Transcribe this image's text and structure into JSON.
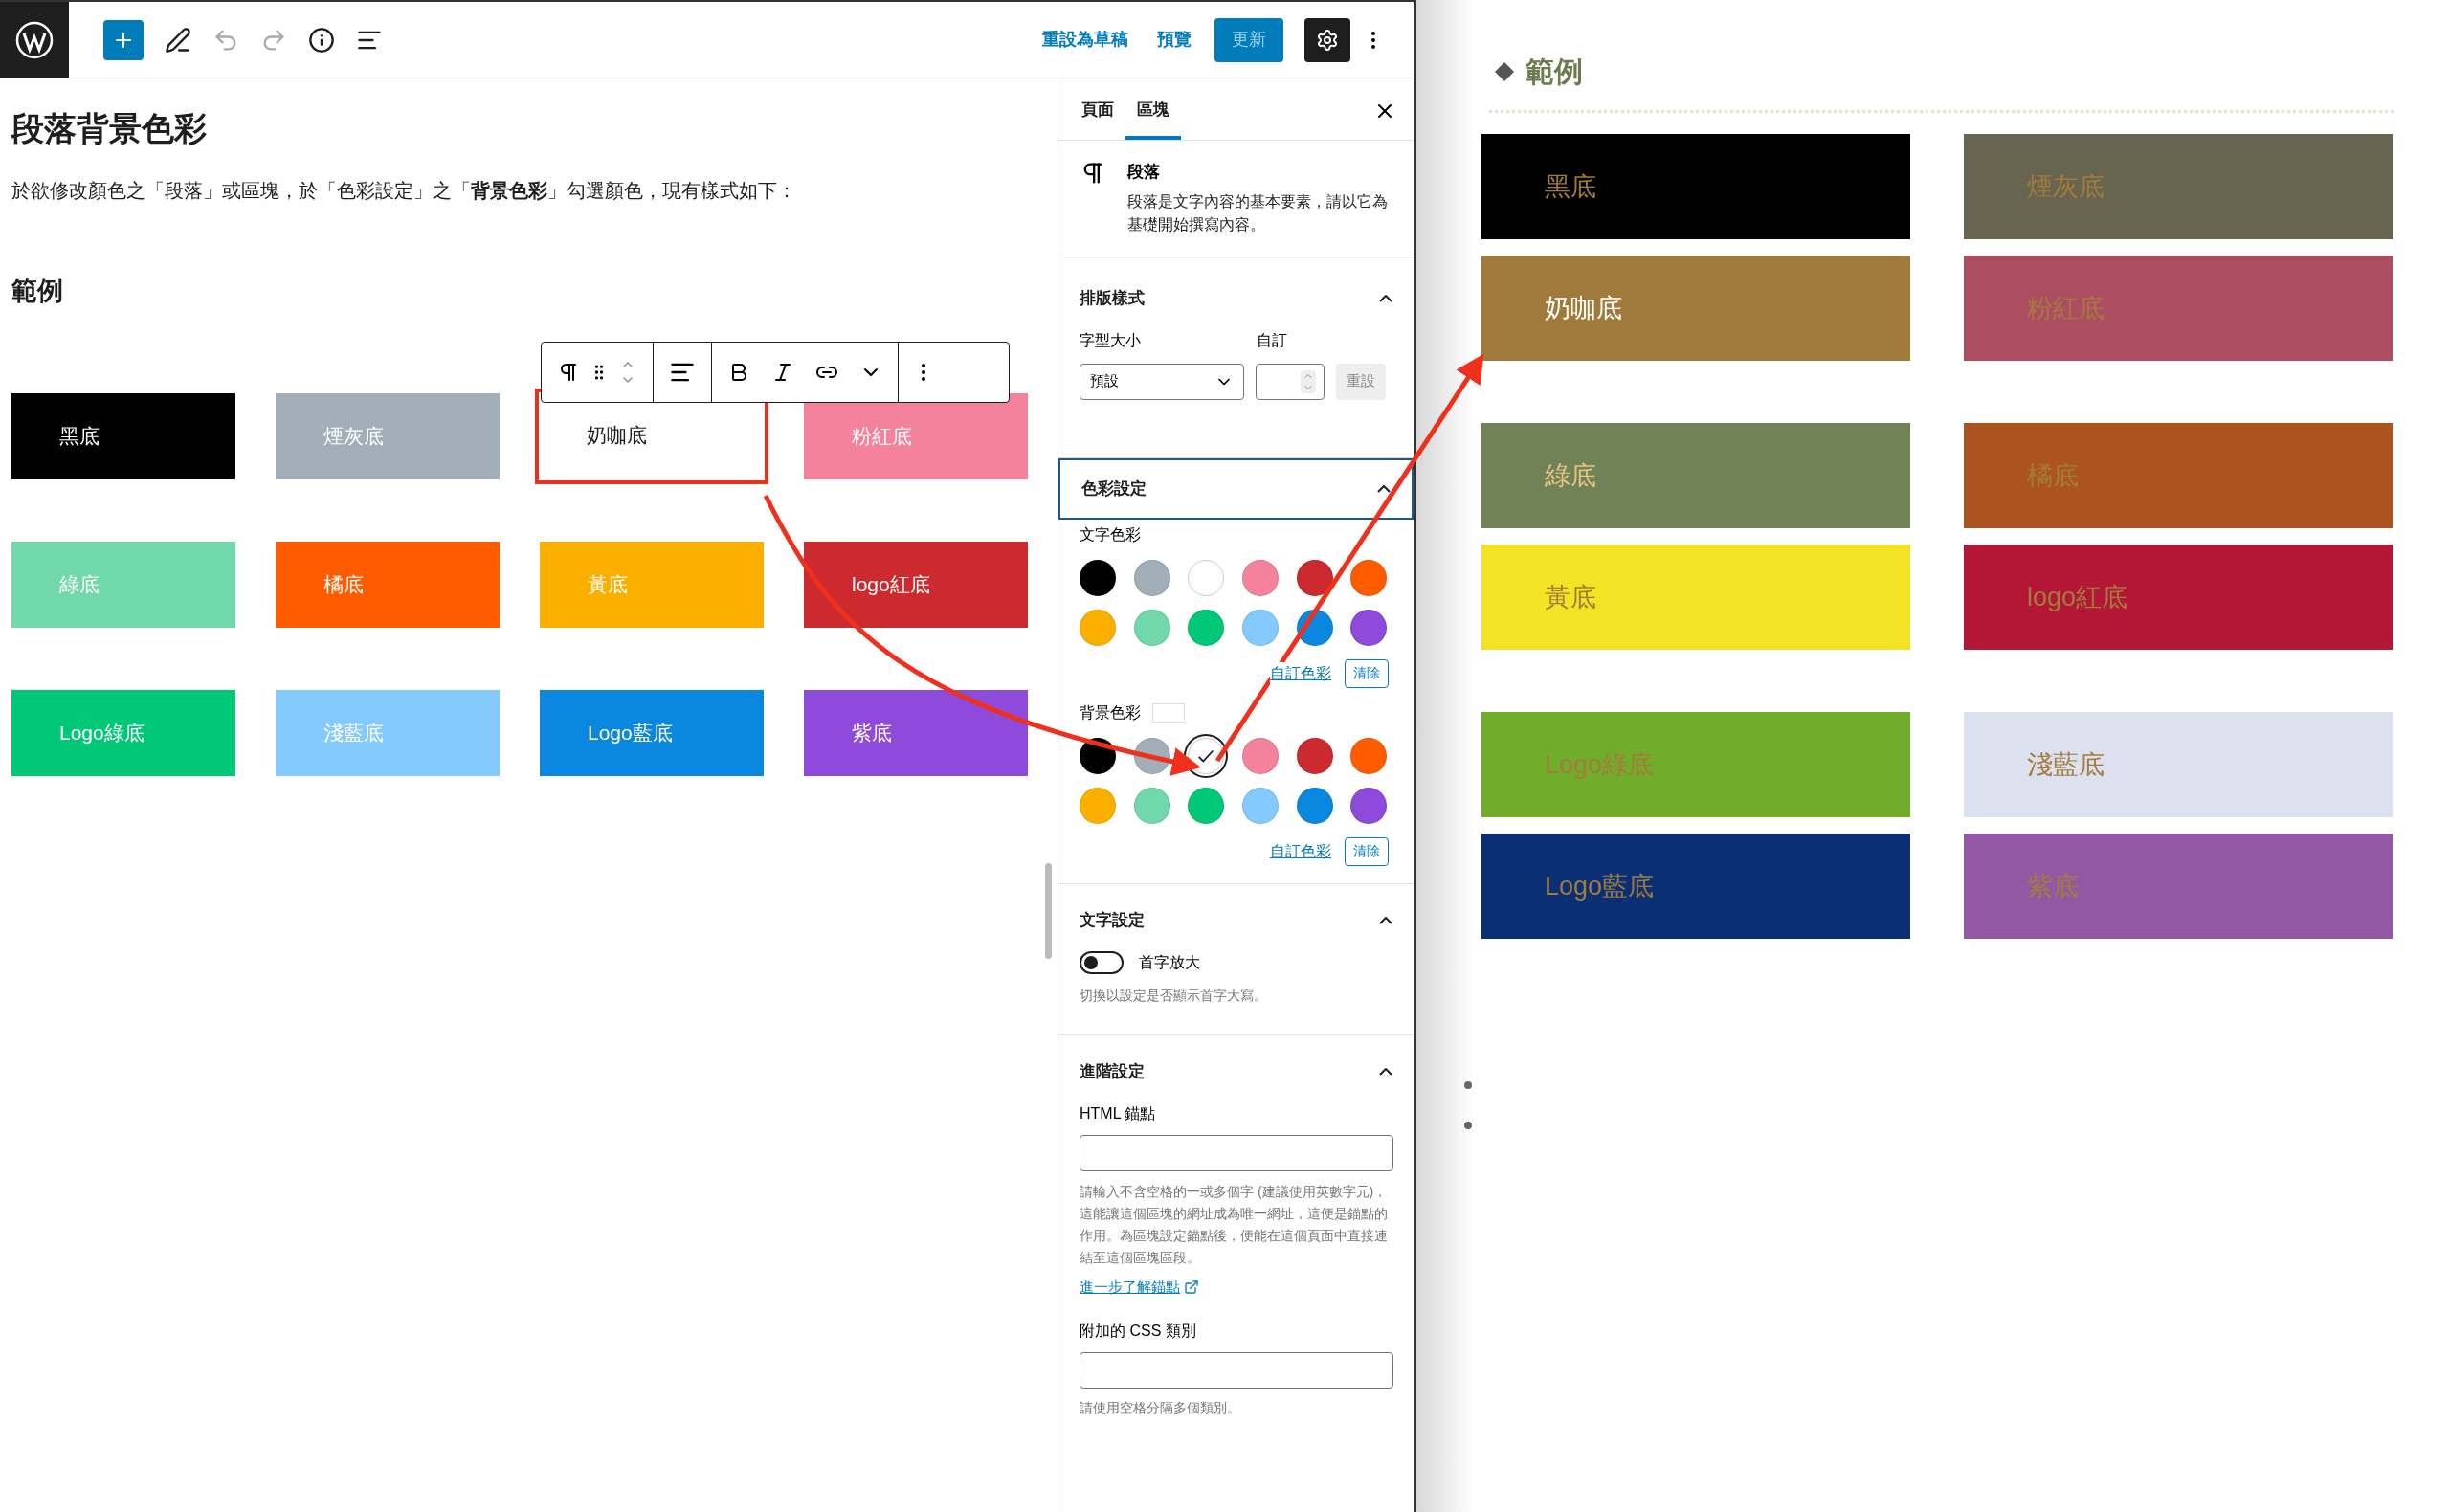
{
  "toolbar": {
    "save_draft": "重設為草稿",
    "preview": "預覽",
    "update": "更新"
  },
  "editor": {
    "title": "段落背景色彩",
    "paragraph": "於欲修改顏色之「段落」或區塊，於「色彩設定」之「**背景色彩**」勾選顏色，現有樣式如下：",
    "heading": "範例",
    "blocks": [
      {
        "label": "黑底",
        "color": "#000000",
        "highlighted": false
      },
      {
        "label": "煙灰底",
        "color": "#a2aeb8",
        "highlighted": false
      },
      {
        "label": "奶咖底",
        "color": "#ffffff",
        "highlighted": true
      },
      {
        "label": "粉紅底",
        "color": "#f5829d",
        "highlighted": false
      },
      {
        "label": "綠底",
        "color": "#70d8aa",
        "highlighted": false
      },
      {
        "label": "橘底",
        "color": "#ff5c00",
        "highlighted": false
      },
      {
        "label": "黃底",
        "color": "#fbb000",
        "highlighted": false
      },
      {
        "label": "logo紅底",
        "color": "#cc2a2e",
        "highlighted": false
      },
      {
        "label": "Logo綠底",
        "color": "#00c877",
        "highlighted": false
      },
      {
        "label": "淺藍底",
        "color": "#84caff",
        "highlighted": false
      },
      {
        "label": "Logo藍底",
        "color": "#0a88e0",
        "highlighted": false
      },
      {
        "label": "紫底",
        "color": "#8e4adb",
        "highlighted": false
      }
    ]
  },
  "sidebar": {
    "tabs": [
      {
        "label": "頁面",
        "selected": false
      },
      {
        "label": "區塊",
        "selected": true
      }
    ],
    "block": {
      "title": "段落",
      "description": "段落是文字內容的基本要素，請以它為基礎開始撰寫內容。"
    },
    "typography": {
      "title": "排版樣式",
      "expanded": true,
      "font_size_label": "字型大小",
      "custom_label": "自訂",
      "font_size_value": "預設",
      "reset": "重設"
    },
    "color": {
      "title": "色彩設定",
      "expanded": true,
      "text_label": "文字色彩",
      "text_swatches": [
        {
          "color": "#000000",
          "selected": false
        },
        {
          "color": "#a2aeb8",
          "selected": false
        },
        {
          "color": "#ffffff",
          "selected": false
        },
        {
          "color": "#f5829d",
          "selected": false
        },
        {
          "color": "#cc2a2e",
          "selected": false
        },
        {
          "color": "#ff5c00",
          "selected": false
        },
        {
          "color": "#fbb000",
          "selected": false
        },
        {
          "color": "#70d8aa",
          "selected": false
        },
        {
          "color": "#00c877",
          "selected": false
        },
        {
          "color": "#84caff",
          "selected": false
        },
        {
          "color": "#0a88e0",
          "selected": false
        },
        {
          "color": "#8e4adb",
          "selected": false
        }
      ],
      "text_custom": "自訂色彩",
      "text_clear": "清除",
      "bg_label": "背景色彩",
      "bg_swatches": [
        {
          "color": "#000000",
          "selected": false
        },
        {
          "color": "#a2aeb8",
          "selected": false
        },
        {
          "color": "#ffffff",
          "selected": true
        },
        {
          "color": "#f5829d",
          "selected": false
        },
        {
          "color": "#cc2a2e",
          "selected": false
        },
        {
          "color": "#ff5c00",
          "selected": false
        },
        {
          "color": "#fbb000",
          "selected": false
        },
        {
          "color": "#70d8aa",
          "selected": false
        },
        {
          "color": "#00c877",
          "selected": false
        },
        {
          "color": "#84caff",
          "selected": false
        },
        {
          "color": "#0a88e0",
          "selected": false
        },
        {
          "color": "#8e4adb",
          "selected": false
        }
      ],
      "bg_custom": "自訂色彩",
      "bg_clear": "清除"
    },
    "text_settings": {
      "title": "文字設定",
      "expanded": true,
      "toggle_label": "首字放大",
      "on": false,
      "help": "切換以設定是否顯示首字大寫。"
    },
    "advanced": {
      "title": "進階設定",
      "expanded": true,
      "anchor_label": "HTML 錨點",
      "anchor_help": "請輸入不含空格的一或多個字 (建議使用英數字元)，這能讓這個區塊的網址成為唯一網址，這便是錨點的作用。為區塊設定錨點後，便能在這個頁面中直接連結至這個區塊區段。",
      "learn_more": "進一步了解錨點",
      "css_label": "附加的 CSS 類別",
      "css_help": "請使用空格分隔多個類別。"
    }
  },
  "preview": {
    "heading": "範例",
    "blocks": [
      {
        "label": "黑底",
        "color": "#000000"
      },
      {
        "label": "煙灰底",
        "color": "#67654f"
      },
      {
        "label": "奶咖底",
        "color": "#a07a3a"
      },
      {
        "label": "粉紅底",
        "color": "#ad4d62"
      },
      {
        "label": "綠底",
        "color": "#708256"
      },
      {
        "label": "橘底",
        "color": "#ab541f"
      },
      {
        "label": "黃底",
        "color": "#f2e424"
      },
      {
        "label": "logo紅底",
        "color": "#b31735"
      },
      {
        "label": "Logo綠底",
        "color": "#70ad2a"
      },
      {
        "label": "淺藍底",
        "color": "#dce0ef"
      },
      {
        "label": "Logo藍底",
        "color": "#0a2f75"
      },
      {
        "label": "紫底",
        "color": "#9358a3"
      }
    ]
  }
}
